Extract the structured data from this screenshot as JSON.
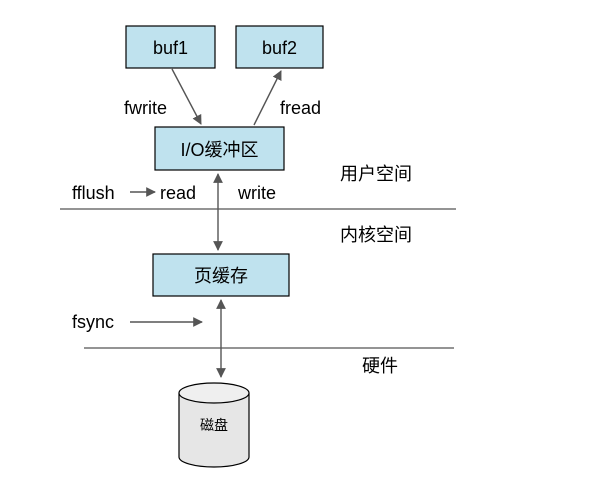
{
  "colors": {
    "box_fill": "#bfe2ee",
    "disk_fill": "#e6e6e6",
    "line": "#555555"
  },
  "nodes": {
    "buf1": "buf1",
    "buf2": "buf2",
    "io_buffer": "I/O缓冲区",
    "page_cache": "页缓存",
    "disk": "磁盘"
  },
  "labels": {
    "fwrite": "fwrite",
    "fread": "fread",
    "fflush": "fflush",
    "read": "read",
    "write": "write",
    "fsync": "fsync"
  },
  "layers": {
    "user_space": "用户空间",
    "kernel_space": "内核空间",
    "hardware": "硬件"
  }
}
